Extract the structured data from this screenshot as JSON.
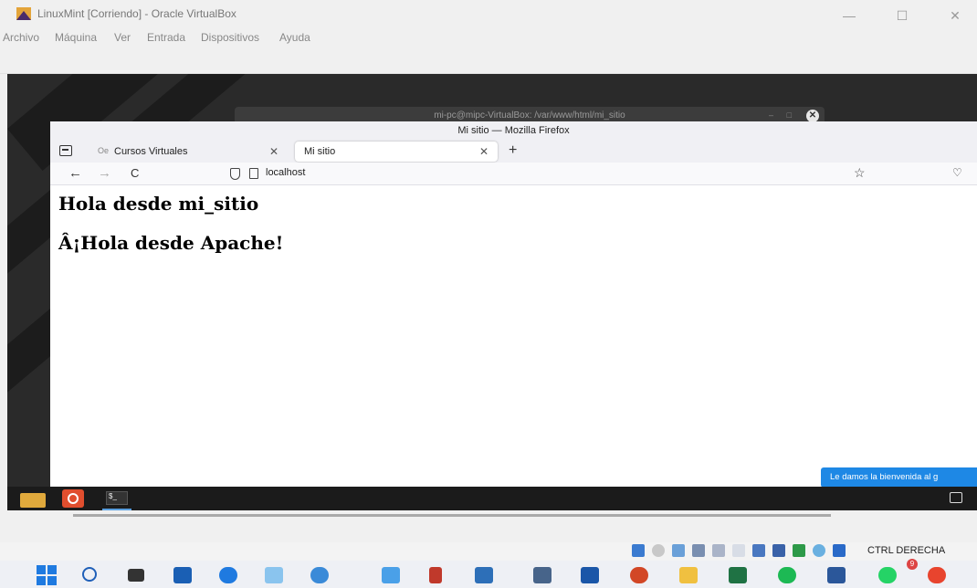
{
  "vbox": {
    "title": "LinuxMint [Corriendo] - Oracle VirtualBox",
    "controls": {
      "minimize": "—",
      "maximize": "☐",
      "close": "✕"
    },
    "menu": [
      "Archivo",
      "Máquina",
      "Ver",
      "Entrada",
      "Dispositivos",
      "Ayuda"
    ],
    "host_key": "CTRL DERECHA"
  },
  "terminal": {
    "title": "mi-pc@mipc-VirtualBox: /var/www/html/mi_sitio",
    "controls": {
      "minimize": "–",
      "maximize": "□",
      "close": "✕"
    }
  },
  "firefox": {
    "window_title": "Mi sitio — Mozilla Firefox",
    "tabs": [
      {
        "favicon": "Oe",
        "label": "Cursos Virtuales",
        "close": "✕"
      },
      {
        "label": "Mi sitio",
        "close": "✕"
      }
    ],
    "new_tab": "+",
    "nav": {
      "back": "←",
      "forward": "→",
      "reload": "C",
      "star": "☆",
      "pocket": "♡"
    },
    "url": "localhost",
    "page": {
      "heading1": "Hola desde mi_sitio",
      "heading2": "Â¡Hola desde Apache!"
    }
  },
  "toast": {
    "text": "Le damos la bienvenida al g"
  },
  "guest_panel": {
    "terminal_label": "$_"
  },
  "taskbar": {
    "badge": "9",
    "icons": [
      "windows-start",
      "search",
      "task-view",
      "file-explorer",
      "outlook",
      "paint",
      "edge-dev",
      "notepad",
      "notion",
      "remote-desktop",
      "calculator",
      "lms",
      "powerpoint",
      "file-manager",
      "excel",
      "spotify",
      "word",
      "whatsapp",
      "chrome"
    ]
  },
  "colors": {
    "accent": "#1e88e5",
    "panel": "#1b1b1b",
    "desktop": "#2a2a2a"
  }
}
